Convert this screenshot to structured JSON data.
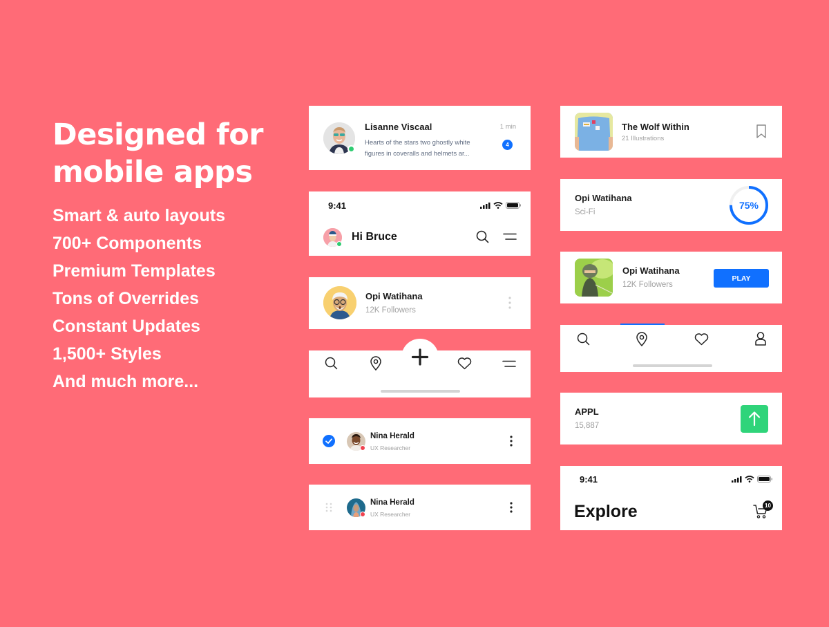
{
  "theme": {
    "background": "#FF6B77",
    "accent_blue": "#1070FF",
    "online_green": "#2ECC71",
    "trend_green": "#2FD47A",
    "offline_red": "#F0424F"
  },
  "hero": {
    "title": "Designed for mobile apps",
    "features": [
      "Smart & auto layouts",
      "700+ Components",
      "Premium Templates",
      "Tons of Overrides",
      "Constant Updates",
      "1,500+ Styles",
      "And much more..."
    ]
  },
  "message_card": {
    "name": "Lisanne Viscaal",
    "time": "1 min",
    "preview": "Hearts of the stars two ghostly white figures in coveralls and helmets ar...",
    "unread_count": "4",
    "avatar_icon": "user-avatar-photo",
    "status": "online"
  },
  "header_card": {
    "status_time": "9:41",
    "greeting": "Hi Bruce",
    "icons": [
      "signal-icon",
      "wifi-icon",
      "battery-icon",
      "search-icon",
      "menu-icon"
    ]
  },
  "profile_card": {
    "name": "Opi Watihana",
    "followers": "12K Followers",
    "more_icon": "vertical-dots-icon"
  },
  "tabbar": {
    "icons": [
      "search-icon",
      "location-pin-icon",
      "plus-icon",
      "heart-icon",
      "menu-icon"
    ]
  },
  "list_rows": [
    {
      "name": "Nina Herald",
      "role": "UX Researcher",
      "checked": true,
      "control": "checkbox"
    },
    {
      "name": "Nina Herald",
      "role": "UX Researcher",
      "checked": false,
      "control": "drag-handle"
    }
  ],
  "book_card": {
    "title": "The Wolf Within",
    "subtitle": "21 Illustrations",
    "action_icon": "bookmark-icon"
  },
  "progress_card": {
    "title": "Opi Watihana",
    "subtitle": "Sci-Fi",
    "progress_percent": 75,
    "progress_label": "75%"
  },
  "game_card": {
    "title": "Opi Watihana",
    "subtitle": "12K Followers",
    "button_label": "PLAY"
  },
  "tabbar2": {
    "icons": [
      "search-icon",
      "location-pin-icon",
      "heart-icon",
      "user-icon"
    ],
    "active_index": 1
  },
  "stock_card": {
    "ticker": "APPL",
    "value": "15,887",
    "trend": "up"
  },
  "explore_card": {
    "status_time": "9:41",
    "title": "Explore",
    "cart_count": "10"
  }
}
